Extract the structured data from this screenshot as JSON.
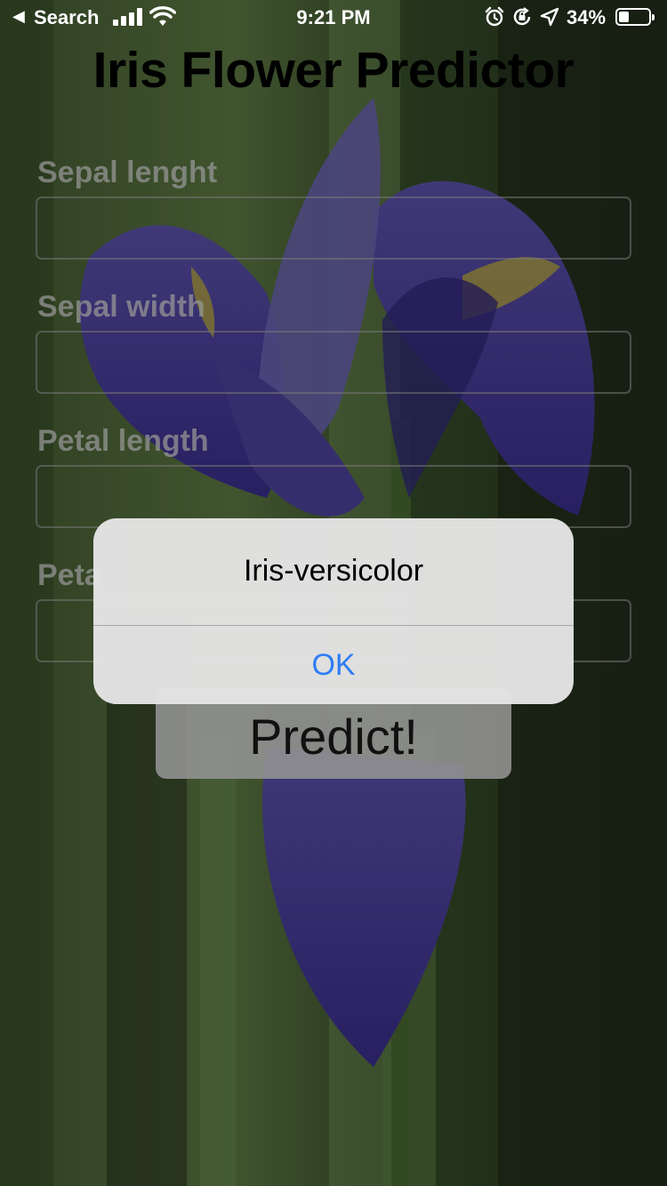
{
  "status_bar": {
    "back_label": "Search",
    "time": "9:21 PM",
    "battery_percent": "34%",
    "battery_level": 0.34
  },
  "app": {
    "title": "Iris Flower Predictor",
    "fields": [
      {
        "label": "Sepal lenght",
        "value": ""
      },
      {
        "label": "Sepal width",
        "value": ""
      },
      {
        "label": "Petal length",
        "value": ""
      },
      {
        "label": "Peta",
        "value": ""
      }
    ],
    "predict_label": "Predict!"
  },
  "alert": {
    "message": "Iris-versicolor",
    "ok_label": "OK"
  },
  "colors": {
    "alert_button": "#2f7df6",
    "flower": "#4b3fa0"
  }
}
